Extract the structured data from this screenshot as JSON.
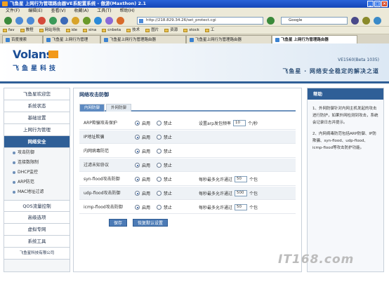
{
  "window": {
    "title": "飞鱼星 上网行为管理路由器VE系配置系统 - 傲游(Maxthon) 2.1"
  },
  "menu": [
    "文件(F)",
    "编辑(E)",
    "查看(V)",
    "收藏(A)",
    "工具(T)",
    "帮助(H)"
  ],
  "toolbar": {
    "address": "http://218.829.34.26/set_protect.cgi",
    "search_placeholder": "Google"
  },
  "bookmarks": [
    "fav",
    "教程",
    "网站导航",
    "ide",
    "sina",
    "cnbeta",
    "技术",
    "图片",
    "资源",
    "stock",
    "工"
  ],
  "tabs": [
    {
      "label": "百度搜索"
    },
    {
      "label": "飞鱼星 上网行为管理"
    },
    {
      "label": "飞鱼星上网行为管理路由器"
    },
    {
      "label": "飞鱼星上网行为管理路由器"
    },
    {
      "label": "飞鱼星 上网行为管理路由器",
      "active": true
    }
  ],
  "header": {
    "logo_en": "Volans",
    "logo_cn": "飞鱼星科技",
    "version": "VE1560(Beta 1035)",
    "slogan": "飞鱼星 · 网络安全稳定的解决之道"
  },
  "sidebar": {
    "items": [
      {
        "label": "飞鱼星欢迎您"
      },
      {
        "label": "系统状态"
      },
      {
        "label": "基础设置"
      },
      {
        "label": "上网行为管理"
      },
      {
        "label": "网络安全",
        "active": true
      }
    ],
    "subitems": [
      "攻击防御",
      "连接数限制",
      "DHCP监控",
      "ARP防范",
      "MAC地址过滤"
    ],
    "items_after": [
      {
        "label": "QOS流量控制"
      },
      {
        "label": "高级选项"
      },
      {
        "label": "虚拟专网"
      },
      {
        "label": "系统工具"
      },
      {
        "label": "飞鱼星科技有限公司"
      }
    ]
  },
  "main": {
    "title": "网络攻击防御",
    "subtabs": [
      {
        "label": "内网防御",
        "active": true
      },
      {
        "label": "外网防御"
      }
    ],
    "enable_label": "启用",
    "disable_label": "禁止",
    "rows": [
      {
        "label": "ARP欺骗攻击保护",
        "enabled": true,
        "extra_prefix": "设置arp发包频率",
        "extra_value": "10",
        "extra_suffix": "个/秒"
      },
      {
        "label": "IP地址欺骗",
        "enabled": true
      },
      {
        "label": "内网病毒防范",
        "enabled": true
      },
      {
        "label": "过滤未知协议",
        "enabled": true
      },
      {
        "label": "syn-flood攻击防御",
        "enabled": true,
        "extra_prefix": "每秒最多允许通过",
        "extra_value": "50",
        "extra_suffix": "个包"
      },
      {
        "label": "udp-flood攻击防御",
        "enabled": true,
        "extra_prefix": "每秒最多允许通过",
        "extra_value": "500",
        "extra_suffix": "个包"
      },
      {
        "label": "icmp-flood攻击防御",
        "enabled": true,
        "extra_prefix": "每秒最多允许通过",
        "extra_value": "50",
        "extra_suffix": "个包"
      }
    ],
    "save_label": "保存",
    "restore_label": "恢复默认设置"
  },
  "help": {
    "title": "帮助",
    "paragraphs": [
      "1、外网防御针对内网主机发起的攻击进行防护，如果外网检测到攻击，系统会记录日志并提示。",
      "2、内网病毒防范包括ARP防御、IP防欺骗、syn-flood、udp-flood、icmp-flood等攻击防护功能。"
    ]
  },
  "watermark": "IT168.com"
}
